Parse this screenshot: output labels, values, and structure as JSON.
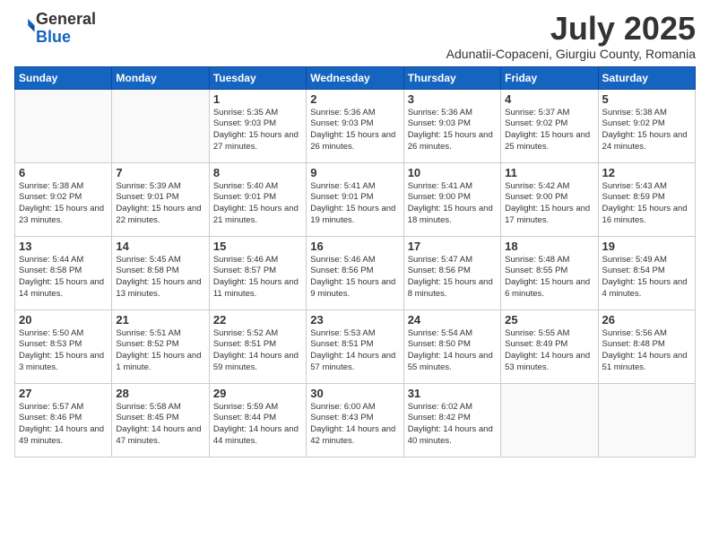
{
  "logo": {
    "general": "General",
    "blue": "Blue"
  },
  "title": "July 2025",
  "location": "Adunatii-Copaceni, Giurgiu County, Romania",
  "headers": [
    "Sunday",
    "Monday",
    "Tuesday",
    "Wednesday",
    "Thursday",
    "Friday",
    "Saturday"
  ],
  "weeks": [
    [
      {
        "day": "",
        "info": ""
      },
      {
        "day": "",
        "info": ""
      },
      {
        "day": "1",
        "info": "Sunrise: 5:35 AM\nSunset: 9:03 PM\nDaylight: 15 hours and 27 minutes."
      },
      {
        "day": "2",
        "info": "Sunrise: 5:36 AM\nSunset: 9:03 PM\nDaylight: 15 hours and 26 minutes."
      },
      {
        "day": "3",
        "info": "Sunrise: 5:36 AM\nSunset: 9:03 PM\nDaylight: 15 hours and 26 minutes."
      },
      {
        "day": "4",
        "info": "Sunrise: 5:37 AM\nSunset: 9:02 PM\nDaylight: 15 hours and 25 minutes."
      },
      {
        "day": "5",
        "info": "Sunrise: 5:38 AM\nSunset: 9:02 PM\nDaylight: 15 hours and 24 minutes."
      }
    ],
    [
      {
        "day": "6",
        "info": "Sunrise: 5:38 AM\nSunset: 9:02 PM\nDaylight: 15 hours and 23 minutes."
      },
      {
        "day": "7",
        "info": "Sunrise: 5:39 AM\nSunset: 9:01 PM\nDaylight: 15 hours and 22 minutes."
      },
      {
        "day": "8",
        "info": "Sunrise: 5:40 AM\nSunset: 9:01 PM\nDaylight: 15 hours and 21 minutes."
      },
      {
        "day": "9",
        "info": "Sunrise: 5:41 AM\nSunset: 9:01 PM\nDaylight: 15 hours and 19 minutes."
      },
      {
        "day": "10",
        "info": "Sunrise: 5:41 AM\nSunset: 9:00 PM\nDaylight: 15 hours and 18 minutes."
      },
      {
        "day": "11",
        "info": "Sunrise: 5:42 AM\nSunset: 9:00 PM\nDaylight: 15 hours and 17 minutes."
      },
      {
        "day": "12",
        "info": "Sunrise: 5:43 AM\nSunset: 8:59 PM\nDaylight: 15 hours and 16 minutes."
      }
    ],
    [
      {
        "day": "13",
        "info": "Sunrise: 5:44 AM\nSunset: 8:58 PM\nDaylight: 15 hours and 14 minutes."
      },
      {
        "day": "14",
        "info": "Sunrise: 5:45 AM\nSunset: 8:58 PM\nDaylight: 15 hours and 13 minutes."
      },
      {
        "day": "15",
        "info": "Sunrise: 5:46 AM\nSunset: 8:57 PM\nDaylight: 15 hours and 11 minutes."
      },
      {
        "day": "16",
        "info": "Sunrise: 5:46 AM\nSunset: 8:56 PM\nDaylight: 15 hours and 9 minutes."
      },
      {
        "day": "17",
        "info": "Sunrise: 5:47 AM\nSunset: 8:56 PM\nDaylight: 15 hours and 8 minutes."
      },
      {
        "day": "18",
        "info": "Sunrise: 5:48 AM\nSunset: 8:55 PM\nDaylight: 15 hours and 6 minutes."
      },
      {
        "day": "19",
        "info": "Sunrise: 5:49 AM\nSunset: 8:54 PM\nDaylight: 15 hours and 4 minutes."
      }
    ],
    [
      {
        "day": "20",
        "info": "Sunrise: 5:50 AM\nSunset: 8:53 PM\nDaylight: 15 hours and 3 minutes."
      },
      {
        "day": "21",
        "info": "Sunrise: 5:51 AM\nSunset: 8:52 PM\nDaylight: 15 hours and 1 minute."
      },
      {
        "day": "22",
        "info": "Sunrise: 5:52 AM\nSunset: 8:51 PM\nDaylight: 14 hours and 59 minutes."
      },
      {
        "day": "23",
        "info": "Sunrise: 5:53 AM\nSunset: 8:51 PM\nDaylight: 14 hours and 57 minutes."
      },
      {
        "day": "24",
        "info": "Sunrise: 5:54 AM\nSunset: 8:50 PM\nDaylight: 14 hours and 55 minutes."
      },
      {
        "day": "25",
        "info": "Sunrise: 5:55 AM\nSunset: 8:49 PM\nDaylight: 14 hours and 53 minutes."
      },
      {
        "day": "26",
        "info": "Sunrise: 5:56 AM\nSunset: 8:48 PM\nDaylight: 14 hours and 51 minutes."
      }
    ],
    [
      {
        "day": "27",
        "info": "Sunrise: 5:57 AM\nSunset: 8:46 PM\nDaylight: 14 hours and 49 minutes."
      },
      {
        "day": "28",
        "info": "Sunrise: 5:58 AM\nSunset: 8:45 PM\nDaylight: 14 hours and 47 minutes."
      },
      {
        "day": "29",
        "info": "Sunrise: 5:59 AM\nSunset: 8:44 PM\nDaylight: 14 hours and 44 minutes."
      },
      {
        "day": "30",
        "info": "Sunrise: 6:00 AM\nSunset: 8:43 PM\nDaylight: 14 hours and 42 minutes."
      },
      {
        "day": "31",
        "info": "Sunrise: 6:02 AM\nSunset: 8:42 PM\nDaylight: 14 hours and 40 minutes."
      },
      {
        "day": "",
        "info": ""
      },
      {
        "day": "",
        "info": ""
      }
    ]
  ]
}
